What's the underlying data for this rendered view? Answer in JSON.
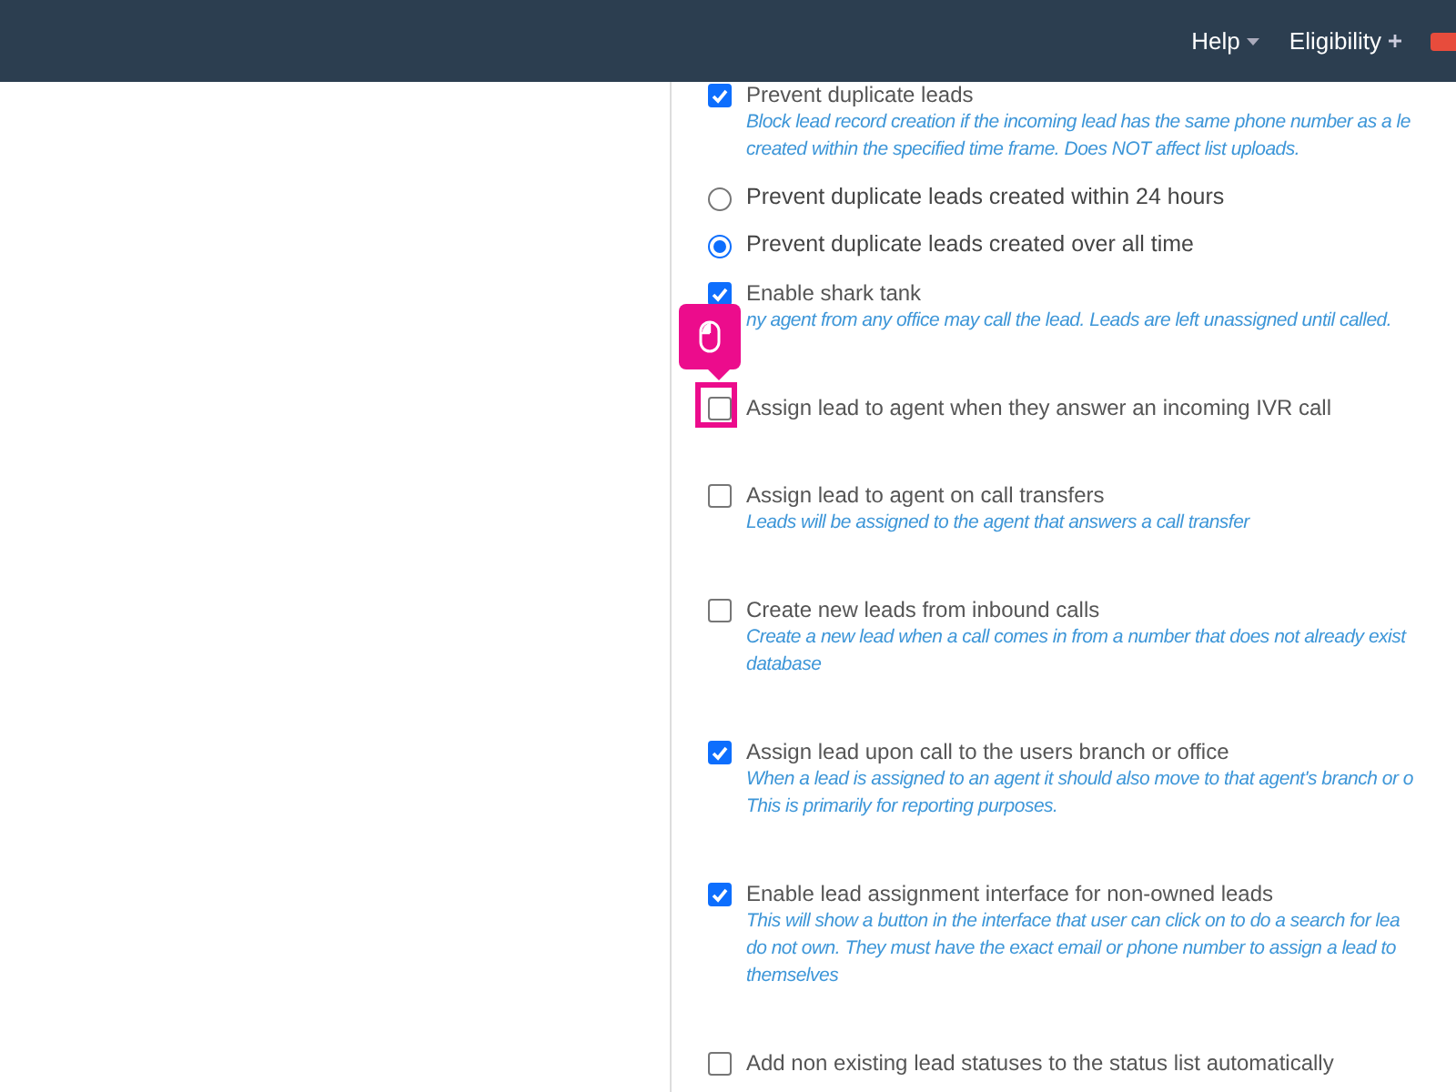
{
  "navbar": {
    "items": [
      {
        "label": "Help",
        "kind": "dropdown"
      },
      {
        "label": "Eligibility",
        "kind": "add"
      }
    ]
  },
  "settings": [
    {
      "kind": "checkbox",
      "label": "Prevent duplicate leads",
      "checked": true,
      "highlighted": false,
      "description": [
        "Block lead record creation if the incoming lead has the same phone number as a le",
        "created within the specified time frame. Does NOT affect list uploads."
      ]
    },
    {
      "kind": "radio",
      "label": "Prevent duplicate leads created within 24 hours",
      "selected": false,
      "highlighted": false
    },
    {
      "kind": "radio",
      "label": "Prevent duplicate leads created over all time",
      "selected": true,
      "highlighted": false
    },
    {
      "kind": "checkbox",
      "label": "Enable shark tank",
      "checked": true,
      "highlighted": false,
      "description": [
        "ny agent from any office may call the lead. Leads are left unassigned until called."
      ]
    },
    {
      "kind": "checkbox",
      "label": "Assign lead to agent when they answer an incoming IVR call",
      "checked": false,
      "highlighted": true
    },
    {
      "kind": "checkbox",
      "label": "Assign lead to agent on call transfers",
      "checked": false,
      "highlighted": false,
      "description": [
        "Leads will be assigned to the agent that answers a call transfer"
      ]
    },
    {
      "kind": "checkbox",
      "label": "Create new leads from inbound calls",
      "checked": false,
      "highlighted": false,
      "description": [
        "Create a new lead when a call comes in from a number that does not already exist",
        "database"
      ]
    },
    {
      "kind": "checkbox",
      "label": "Assign lead upon call to the users branch or office",
      "checked": true,
      "highlighted": false,
      "description": [
        "When a lead is assigned to an agent it should also move to that agent's branch or o",
        "This is primarily for reporting purposes."
      ]
    },
    {
      "kind": "checkbox",
      "label": "Enable lead assignment interface for non-owned leads",
      "checked": true,
      "highlighted": false,
      "description": [
        "This will show a button in the interface that user can click on to do a search for lea",
        "do not own. They must have the exact email or phone number to assign a lead to",
        "themselves"
      ]
    },
    {
      "kind": "checkbox",
      "label": "Add non existing lead statuses to the status list automatically",
      "checked": false,
      "highlighted": false
    }
  ]
}
